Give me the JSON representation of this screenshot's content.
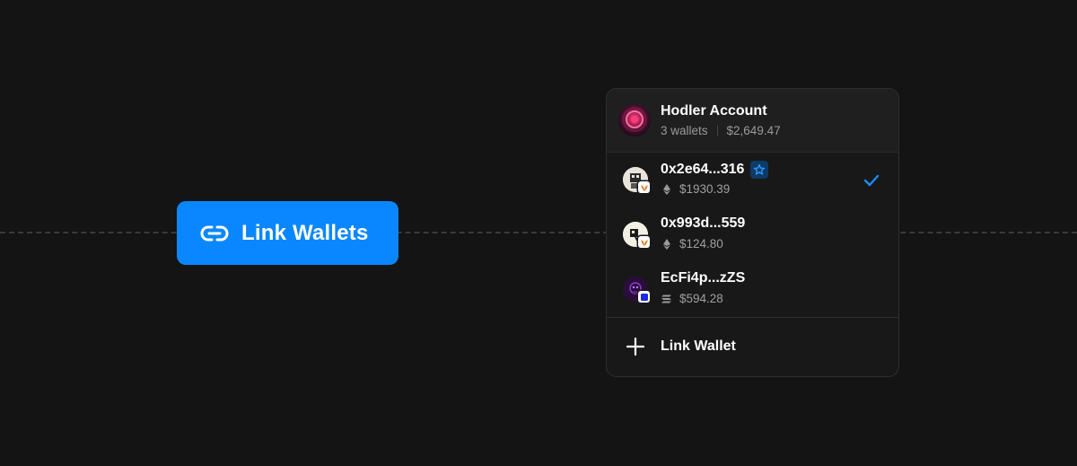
{
  "link_button": {
    "label": "Link Wallets",
    "icon": "link-icon",
    "color": "#0a87ff"
  },
  "account": {
    "name": "Hodler Account",
    "wallet_count": "3 wallets",
    "total_balance": "$2,649.47"
  },
  "wallets": [
    {
      "address": "0x2e64...316",
      "balance": "$1930.39",
      "chain_icon": "ethereum-icon",
      "wallet_icon": "metamask-icon",
      "starred": true,
      "selected": true
    },
    {
      "address": "0x993d...559",
      "balance": "$124.80",
      "chain_icon": "ethereum-icon",
      "wallet_icon": "metamask-icon",
      "starred": false,
      "selected": false
    },
    {
      "address": "EcFi4p...zZS",
      "balance": "$594.28",
      "chain_icon": "solana-icon",
      "wallet_icon": "wallet-app-icon",
      "starred": false,
      "selected": false
    }
  ],
  "add_wallet": {
    "label": "Link Wallet",
    "icon": "plus-icon"
  },
  "colors": {
    "background": "#141414",
    "panel": "#181818",
    "accent": "#0a87ff",
    "star_badge": "#0e3a66"
  }
}
